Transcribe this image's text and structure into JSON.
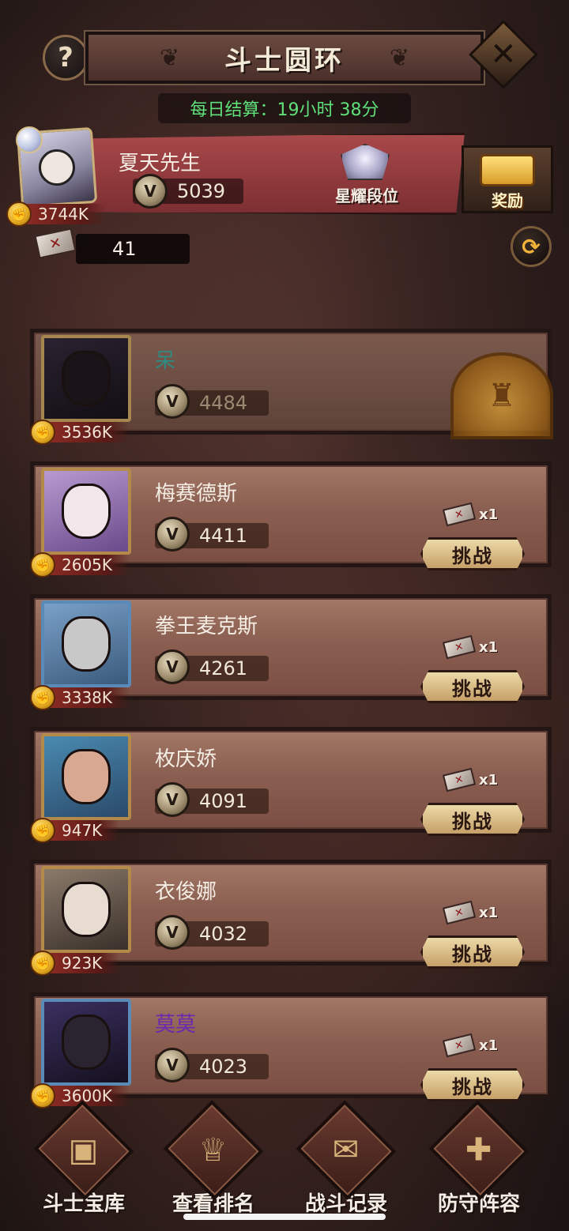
{
  "header": {
    "title": "斗士圆环",
    "help_label": "?",
    "close_label": "✕",
    "daily_settlement": "每日结算：19小时 38分"
  },
  "player": {
    "name": "夏天先生",
    "score": "5039",
    "power": "3744K",
    "rank_label": "星耀段位",
    "reward_label": "奖励",
    "ticket_count": "41"
  },
  "opponents": [
    {
      "name": "呆",
      "score": "4484",
      "power": "3536K",
      "name_color": "#2f8a80",
      "defeated": true
    },
    {
      "name": "梅赛德斯",
      "score": "4411",
      "power": "2605K",
      "cost": "x1",
      "challenge_label": "挑战"
    },
    {
      "name": "拳王麦克斯",
      "score": "4261",
      "power": "3338K",
      "cost": "x1",
      "challenge_label": "挑战"
    },
    {
      "name": "枚庆娇",
      "score": "4091",
      "power": "947K",
      "cost": "x1",
      "challenge_label": "挑战"
    },
    {
      "name": "衣俊娜",
      "score": "4032",
      "power": "923K",
      "cost": "x1",
      "challenge_label": "挑战"
    },
    {
      "name": "莫莫",
      "score": "4023",
      "power": "3600K",
      "name_color": "#6a2ab0",
      "cost": "x1",
      "challenge_label": "挑战"
    }
  ],
  "nav": [
    {
      "label": "斗士宝库",
      "icon": "treasure-chest-icon"
    },
    {
      "label": "查看排名",
      "icon": "trophy-icon"
    },
    {
      "label": "战斗记录",
      "icon": "scroll-icon"
    },
    {
      "label": "防守阵容",
      "icon": "shield-icon"
    }
  ],
  "colors": {
    "timer_green": "#5fe07a",
    "player_banner": "#a8484a",
    "challenge_button": "#ecd9a8"
  }
}
